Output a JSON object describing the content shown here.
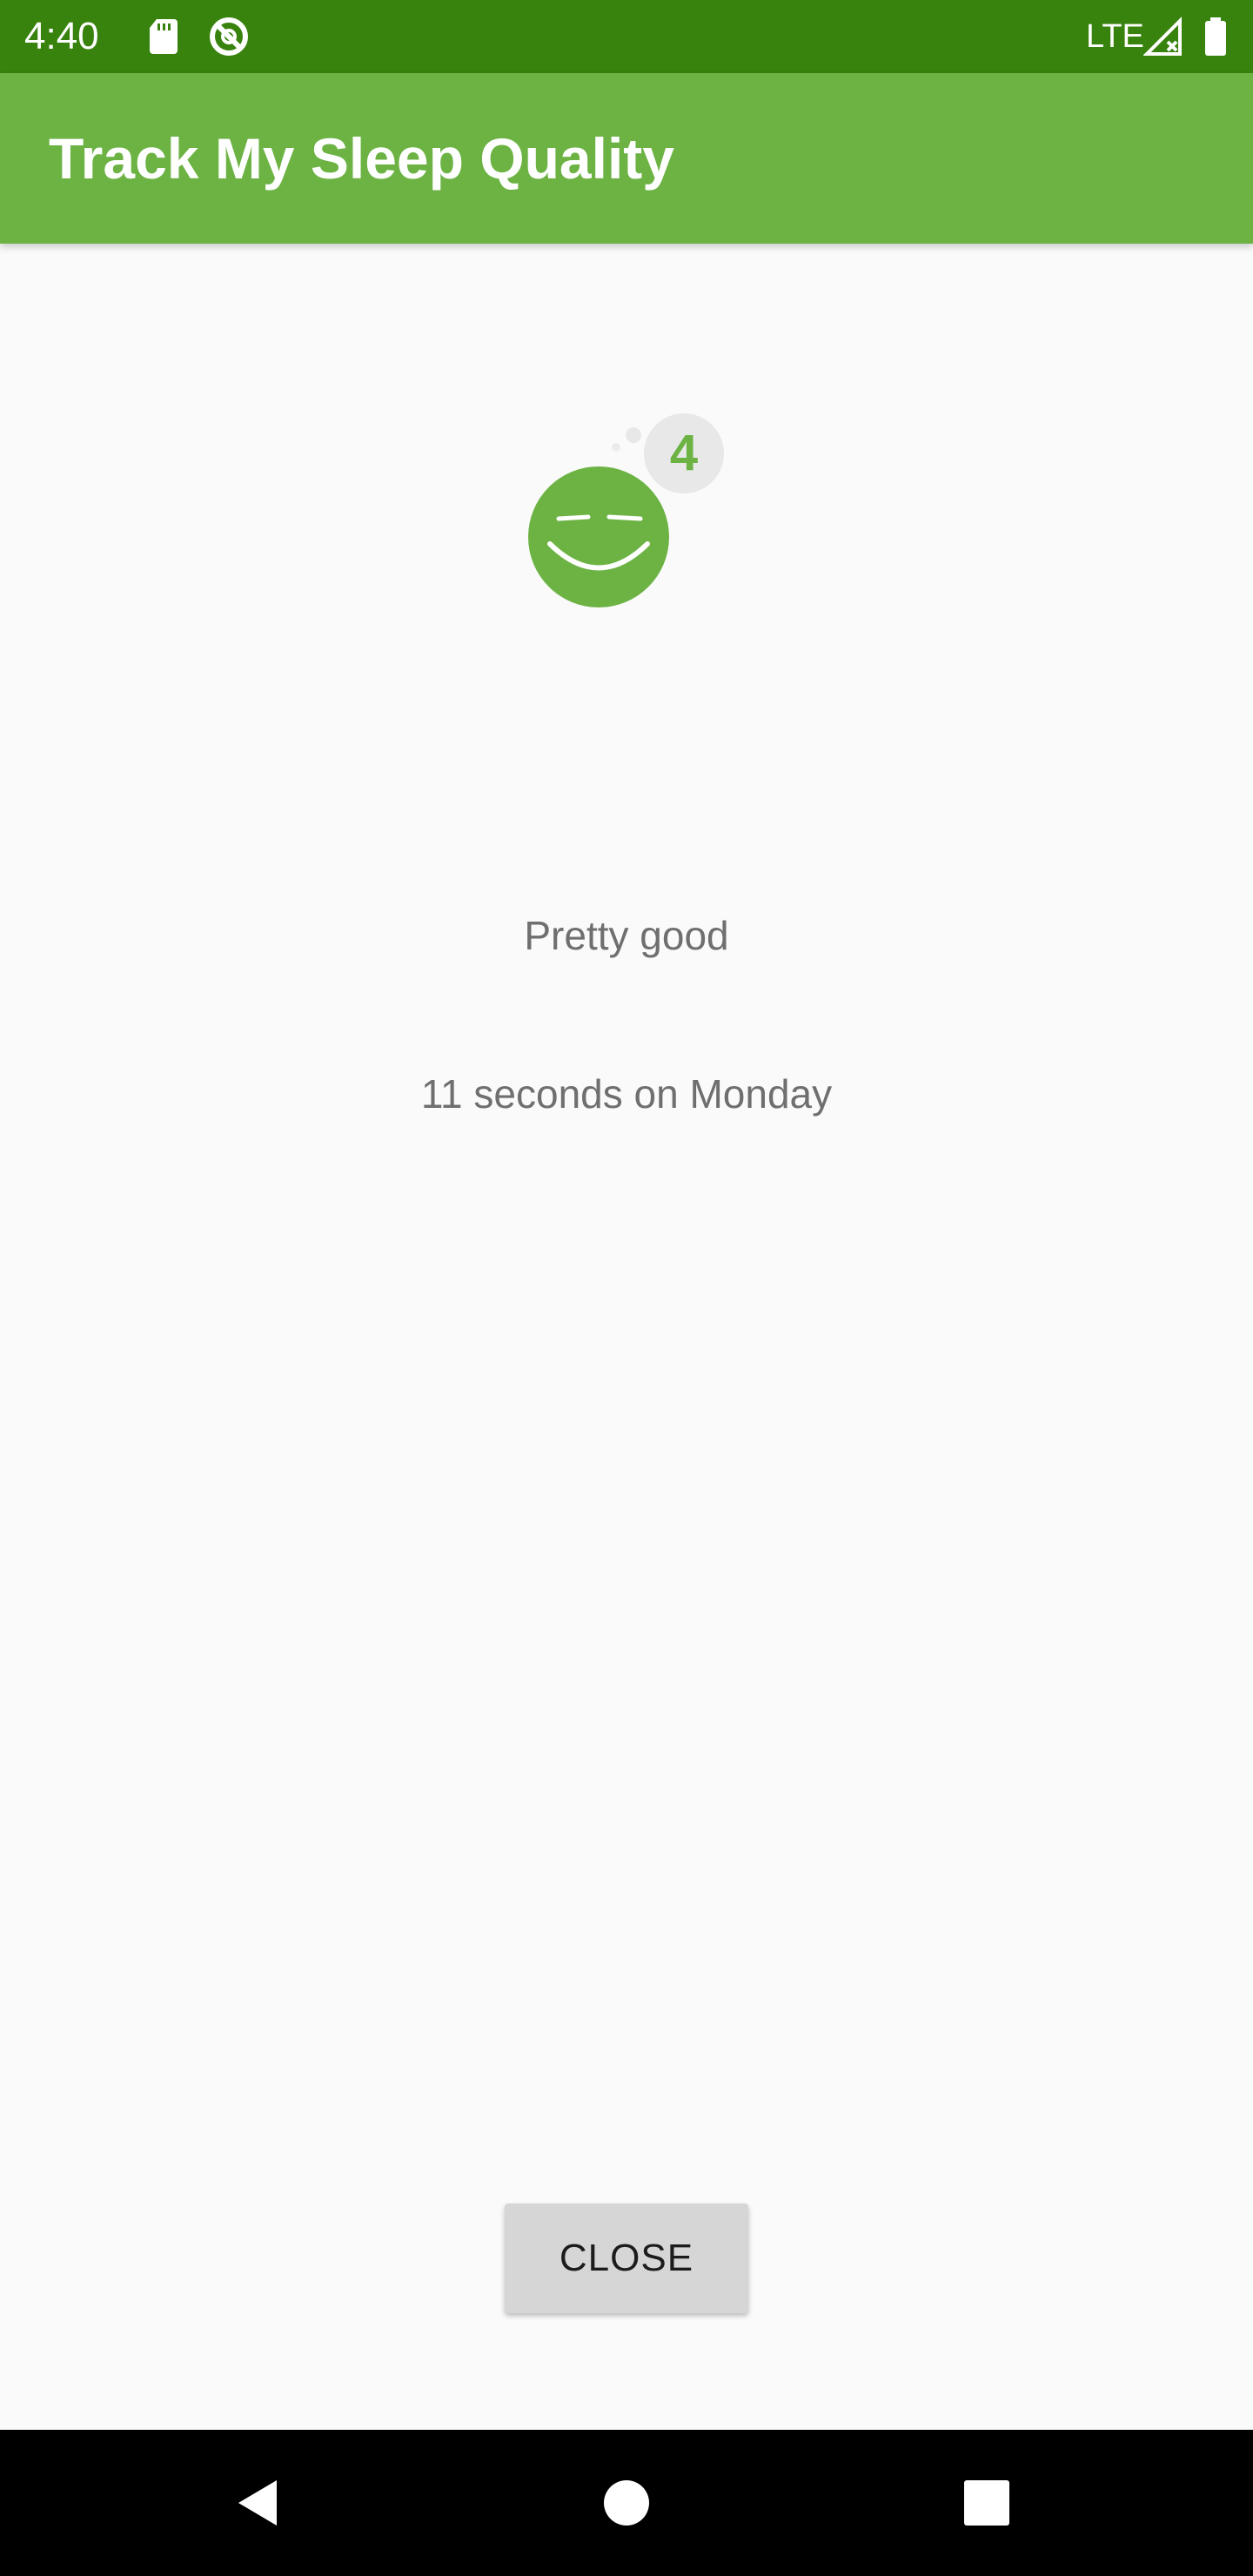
{
  "status_bar": {
    "time": "4:40",
    "network": "LTE",
    "icons": [
      "sd-card-icon",
      "do-not-disturb-icon",
      "signal-icon",
      "battery-icon"
    ],
    "background": "#38820e"
  },
  "app_bar": {
    "title": "Track My Sleep Quality",
    "background": "#6cb344"
  },
  "sleep_detail": {
    "quality_icon": "sleep-face-icon",
    "quality_number": "4",
    "quality_text": "Pretty good",
    "duration_text": "11 seconds on Monday",
    "accent": "#6cb344"
  },
  "actions": {
    "close_label": "CLOSE"
  },
  "nav_bar": {
    "icons": [
      "back-icon",
      "home-icon",
      "recents-icon"
    ]
  }
}
